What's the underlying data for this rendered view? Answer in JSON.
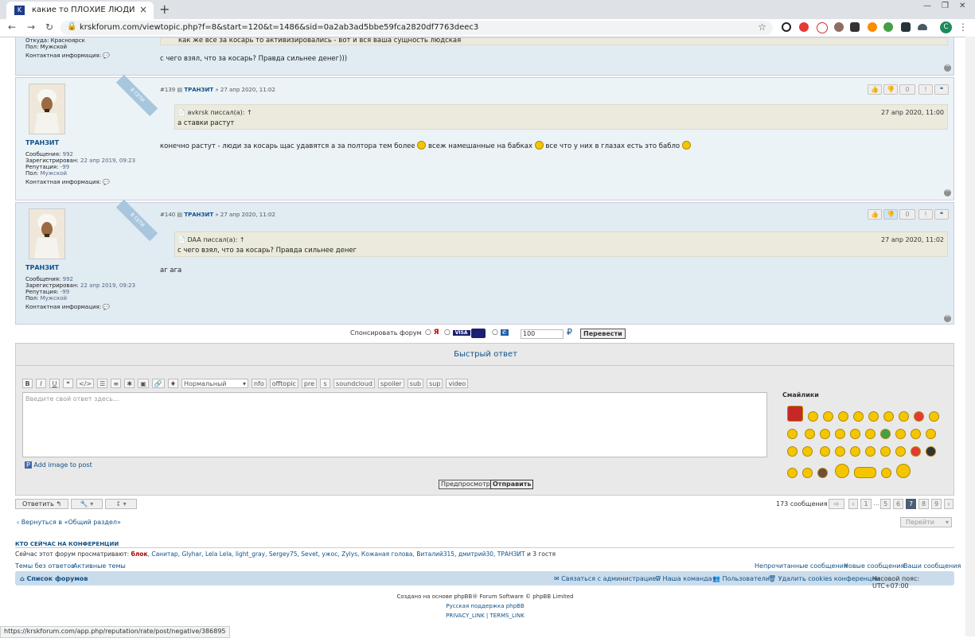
{
  "browser": {
    "tab_title": "какие то ПЛОХИЕ ЛЮДИ портя",
    "url": "krskforum.com/viewtopic.php?f=8&start=120&t=1486&sid=0a2ab3ad5bbe59fca2820df7763deec3",
    "profile_initial": "C"
  },
  "top_fragment": {
    "meta_lines": [
      "Откуда: Красноярск",
      "Пол: Мужской",
      "Контактная информация:"
    ],
    "quote_tail": "как же все за косарь то активизировались - вот и вся ваша сущность людская",
    "body": "с чего взял, что за косарь? Правда сильнее денег)))"
  },
  "posts": [
    {
      "online": "В СЕТИ",
      "author": "ТРАНЗИТ",
      "number": "#139",
      "date": "27 апр 2020, 11:02",
      "quote_author": "avkrsk писсал(а): ↑",
      "quote_date": "27 апр 2020, 11:00",
      "quote_text": "а ставки растут",
      "text": "конечно растут - люди за косарь щас удавятся а за полтора тем более",
      "text2": "всеж намешанные на бабках",
      "text3": "все что у них в глазах есть это бабло",
      "rating": "0",
      "meta": {
        "posts_label": "Сообщения:",
        "posts": "992",
        "reg_label": "Зарегистрирован:",
        "reg": "22 апр 2019, 09:23",
        "rep_label": "Репутация:",
        "rep": "-99",
        "sex_label": "Пол:",
        "sex": "Мужской",
        "contact": "Контактная информация:"
      }
    },
    {
      "online": "В СЕТИ",
      "author": "ТРАНЗИТ",
      "number": "#140",
      "date": "27 апр 2020, 11:02",
      "quote_author": "DAA писсал(а): ↑",
      "quote_date": "27 апр 2020, 11:02",
      "quote_text": "с чего взял, что за косарь? Правда сильнее денег",
      "text": "аг ага",
      "rating": "0",
      "meta": {
        "posts_label": "Сообщения:",
        "posts": "992",
        "reg_label": "Зарегистрирован:",
        "reg": "22 апр 2019, 09:23",
        "rep_label": "Репутация:",
        "rep": "-99",
        "sex_label": "Пол:",
        "sex": "Мужской",
        "contact": "Контактная информация:"
      }
    }
  ],
  "sponsor": {
    "label": "Спонсировать форум",
    "amount": "100",
    "currency": "₽",
    "button": "Перевести",
    "opt_ya": "Я",
    "opt_visa": "VISA"
  },
  "quick_reply": {
    "title": "Быстрый ответ",
    "toolbar": [
      "B",
      "I",
      "U",
      "❝",
      "</>",
      "☰",
      "≡",
      "✱",
      "▣",
      "🔗",
      "♦"
    ],
    "font_select": "Нормальный",
    "tags": [
      "nfo",
      "offtopic",
      "pre",
      "s",
      "soundcloud",
      "spoiler",
      "sub",
      "sup",
      "video"
    ],
    "placeholder": "Введите свой ответ здесь...",
    "add_image": "Add image to post",
    "smilies_label": "Смайлики",
    "preview": "Предпросмотр",
    "submit": "Отправить"
  },
  "actions": {
    "reply": "Ответить",
    "count": "173 сообщения",
    "pages": [
      "1",
      "…",
      "5",
      "6",
      "7",
      "8",
      "9"
    ],
    "current_page": "7",
    "back": "Вернуться в «Общий раздел»",
    "jump": "Перейти"
  },
  "online_block": {
    "title": "КТО СЕЙЧАС НА КОНФЕРЕНЦИИ",
    "prefix": "Сейчас этот форум просматривают:",
    "users_first": "блок",
    "users": ", Санитар, Glyhar, Lela Lela, light_gray, Sergey75, Sevet, ужос, Zylys, Кожаная голова, Виталий315, дмитрий30, ТРАНЗИТ",
    "guests": "и 3 гостя"
  },
  "footer_links": {
    "left1": "Темы без ответов",
    "left2": "Активные темы",
    "right1": "Непрочитанные сообщения",
    "right2": "Новые сообщения",
    "right3": "Ваши сообщения"
  },
  "navbar": {
    "home": "Список форумов",
    "contact": "Связаться с администрацией",
    "team": "Наша команда",
    "users": "Пользователи",
    "cookies": "Удалить cookies конференции",
    "tz": "Часовой пояс: UTC+07:00"
  },
  "credits": {
    "line1": "Создано на основе phpBB® Forum Software © phpBB Limited",
    "line2": "Русская поддержка phpBB",
    "line3": "PRIVACY_LINK | TERMS_LINK"
  },
  "status_url": "https://krskforum.com/app.php/reputation/rate/post/negative/386895"
}
